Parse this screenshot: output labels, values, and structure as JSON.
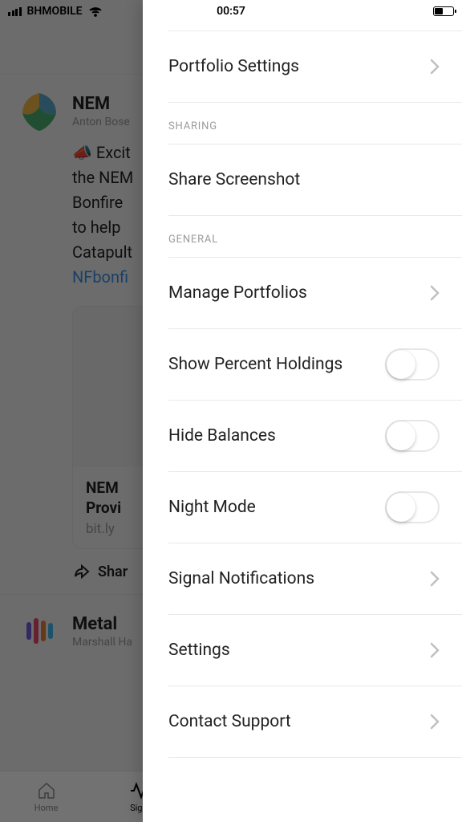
{
  "status_bar": {
    "carrier": "BHMOBILE",
    "time": "00:57"
  },
  "feed": {
    "nem": {
      "title": "NEM",
      "author": "Anton Bose",
      "text_line1": "📣 Excit",
      "text_line2": "the NEM",
      "text_line3": "Bonfire",
      "text_line4": "to help",
      "text_line5": "Catapult",
      "link_text": "NFbonfi",
      "card_title": "NEM",
      "card_subtitle": "Provi",
      "card_url": "bit.ly",
      "share": "Shar"
    },
    "metal": {
      "title": "Metal",
      "author": "Marshall Ha"
    }
  },
  "tabs": {
    "home": "Home",
    "signal": "Sign"
  },
  "panel": {
    "portfolio_settings": "Portfolio Settings",
    "section_sharing": "SHARING",
    "share_screenshot": "Share Screenshot",
    "section_general": "GENERAL",
    "manage_portfolios": "Manage Portfolios",
    "show_percent_holdings": "Show Percent Holdings",
    "hide_balances": "Hide Balances",
    "night_mode": "Night Mode",
    "signal_notifications": "Signal Notifications",
    "settings": "Settings",
    "contact_support": "Contact Support"
  },
  "toggle_states": {
    "show_percent_holdings": false,
    "hide_balances": false,
    "night_mode": false
  }
}
